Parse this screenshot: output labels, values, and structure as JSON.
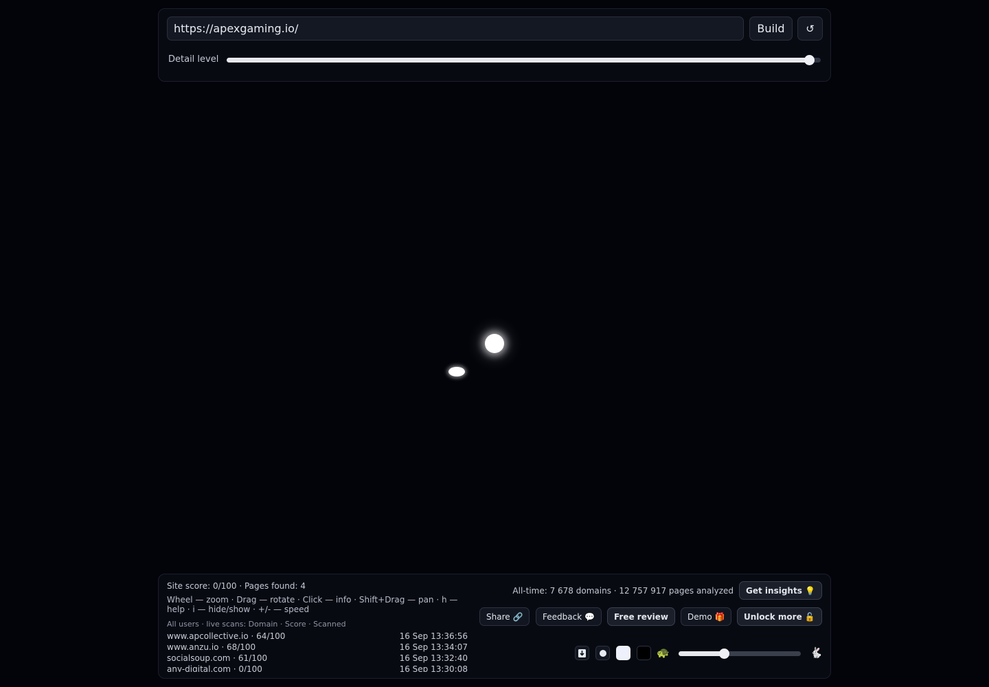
{
  "top": {
    "url_value": "https://apexgaming.io/",
    "build_label": "Build",
    "reset_label": "↺",
    "detail_label": "Detail level",
    "detail_level": 0.98
  },
  "bottom": {
    "site_score": "Site score: 0/100 · Pages found: 4",
    "help": "Wheel — zoom · Drag — rotate · Click — info · Shift+Drag — pan · h — help · i — hide/show · +/- — speed",
    "scans_header": "All users · live scans: Domain · Score · Scanned",
    "scans": [
      {
        "domain": "www.apcollective.io · 64/100",
        "time": "16 Sep 13:36:56"
      },
      {
        "domain": "www.anzu.io · 68/100",
        "time": "16 Sep 13:34:07"
      },
      {
        "domain": "socialsoup.com · 61/100",
        "time": "16 Sep 13:32:40"
      },
      {
        "domain": "any-digital.com · 0/100",
        "time": "16 Sep 13:30:08"
      }
    ],
    "alltime": "All-time: 7 678 domains · 12 757 917 pages analyzed",
    "insights_label": "Get insights 💡",
    "share_label": "Share 🔗",
    "feedback_label": "Feedback 💬",
    "review_label": "Free review",
    "demo_label": "Demo 🎁",
    "unlock_label": "Unlock more 🔓",
    "turtle_icon": "🐢",
    "rabbit_icon": "🐇",
    "speed_level": 0.37
  },
  "icons": {
    "download": "download-icon",
    "dot": "dot-icon",
    "light": "light-swatch",
    "dark": "dark-swatch"
  }
}
